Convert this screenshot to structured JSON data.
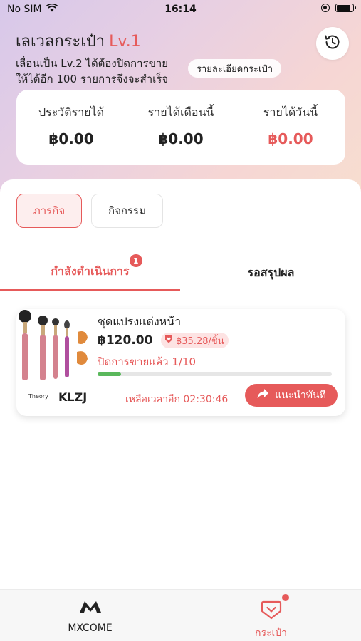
{
  "status_bar": {
    "carrier": "No SIM",
    "time": "16:14"
  },
  "header": {
    "title": "เลเวลกระเป๋า",
    "level": "Lv.1",
    "subtitle_line1": "เลื่อนเป็น Lv.2 ได้ต้องปิดการขาย",
    "subtitle_line2": "ให้ได้อีก 100 รายการจึงจะสำเร็จ",
    "wallet_detail_label": "รายละเอียดกระเป๋า",
    "history_icon": "history-clock-icon"
  },
  "income": [
    {
      "label": "ประวัติรายได้",
      "value": "฿0.00"
    },
    {
      "label": "รายได้เดือนนี้",
      "value": "฿0.00"
    },
    {
      "label": "รายได้วันนี้",
      "value": "฿0.00"
    }
  ],
  "filters": {
    "active": "ภารกิจ",
    "inactive": "กิจกรรม"
  },
  "tabs": {
    "in_progress": "กำลังดำเนินการ",
    "in_progress_badge": "1",
    "pending": "รอสรุปผล"
  },
  "task": {
    "product_name": "ชุดแปรงแต่งหน้า",
    "price": "฿120.00",
    "commission": "฿35.28/ชิ้น",
    "progress_text": "ปิดการขายแล้ว 1/10",
    "progress_fraction": 0.1,
    "brand_small": "Theory",
    "brand_name": "KLZJ",
    "countdown": "เหลือเวลาอีก 02:30:46",
    "recommend_label": "แนะนำทันที"
  },
  "bottom_nav": {
    "home_label": "MXCOME",
    "wallet_label": "กระเป๋า"
  },
  "colors": {
    "accent": "#e65a5a",
    "progress": "#5ab85c"
  }
}
